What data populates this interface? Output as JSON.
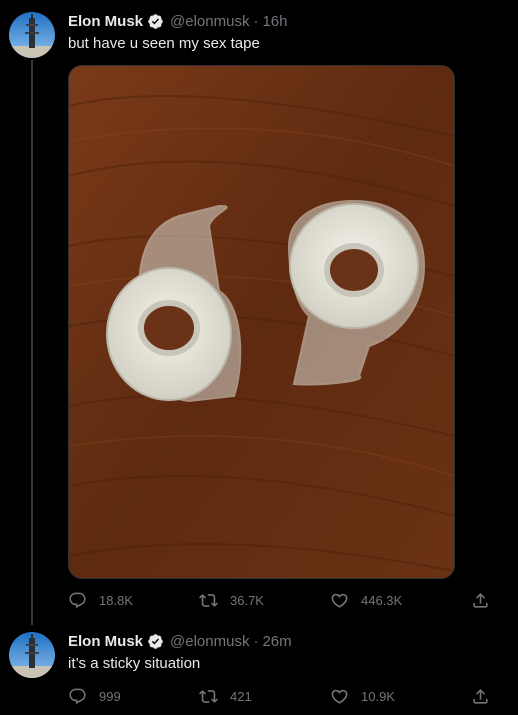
{
  "tweets": [
    {
      "author_name": "Elon Musk",
      "handle": "@elonmusk",
      "separator": "·",
      "time": "16h",
      "text": "but have u seen my sex tape",
      "replies": "18.8K",
      "retweets": "36.7K",
      "likes": "446.3K"
    },
    {
      "author_name": "Elon Musk",
      "handle": "@elonmusk",
      "separator": "·",
      "time": "26m",
      "text": "it’s a sticky situation",
      "replies": "999",
      "retweets": "421",
      "likes": "10.9K"
    }
  ],
  "icons": {
    "verified": "verified-badge-icon",
    "reply": "reply-icon",
    "retweet": "retweet-icon",
    "like": "heart-icon",
    "share": "share-icon"
  },
  "colors": {
    "background": "#000000",
    "text_primary": "#e7e9ea",
    "text_secondary": "#71767b",
    "thread_line": "#333639"
  }
}
